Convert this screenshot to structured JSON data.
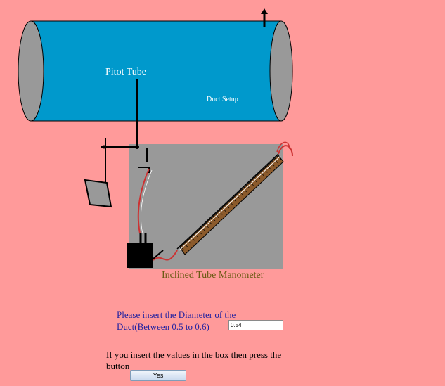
{
  "labels": {
    "pitot_tube": "Pitot Tube",
    "duct_setup": "Duct Setup",
    "manometer": "Inclined Tube Manometer"
  },
  "prompt": {
    "line1": "Please insert the Diameter of the",
    "line2": "Duct(Between 0.5 to 0.6)"
  },
  "diameter_input": {
    "value": "0.54"
  },
  "instruction": {
    "line1": "If you insert the values in the box then press the",
    "line2": "button"
  },
  "yes_button": {
    "label": "Yes"
  },
  "colors": {
    "background": "#ff9a9a",
    "duct": "#0099cc",
    "duct_end": "#999999",
    "manometer_panel": "#999999",
    "tube": "#cc3333",
    "ruler": "#8b5a2b"
  }
}
